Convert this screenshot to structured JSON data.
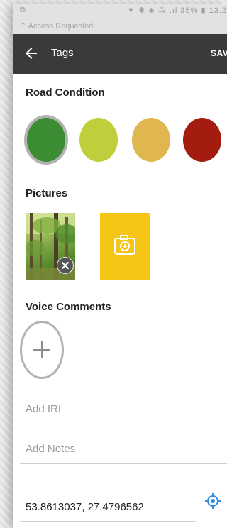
{
  "status_bar": {
    "left_icon": "cast-icon",
    "right_text": "▼ ✱ ◈ ⁂ .ıl 35% ▮ 13:2",
    "notification": "⌃  Access Requested"
  },
  "app_bar": {
    "title": "Tags",
    "save_label": "SAVE"
  },
  "road_condition": {
    "label": "Road Condition",
    "options": [
      {
        "color": "#3b8c33",
        "selected": true
      },
      {
        "color": "#bfcf3c",
        "selected": false
      },
      {
        "color": "#e0b74e",
        "selected": false
      },
      {
        "color": "#a41c10",
        "selected": false
      }
    ]
  },
  "pictures": {
    "label": "Pictures",
    "add_icon": "camera-plus-icon",
    "remove_icon": "close-icon"
  },
  "voice_comments": {
    "label": "Voice Comments",
    "add_icon": "plus-icon"
  },
  "fields": {
    "iri_placeholder": "Add IRI",
    "notes_placeholder": "Add Notes"
  },
  "location": {
    "value": "53.8613037, 27.4796562",
    "icon": "gps-locate-icon",
    "icon_color": "#2f8ee0"
  }
}
